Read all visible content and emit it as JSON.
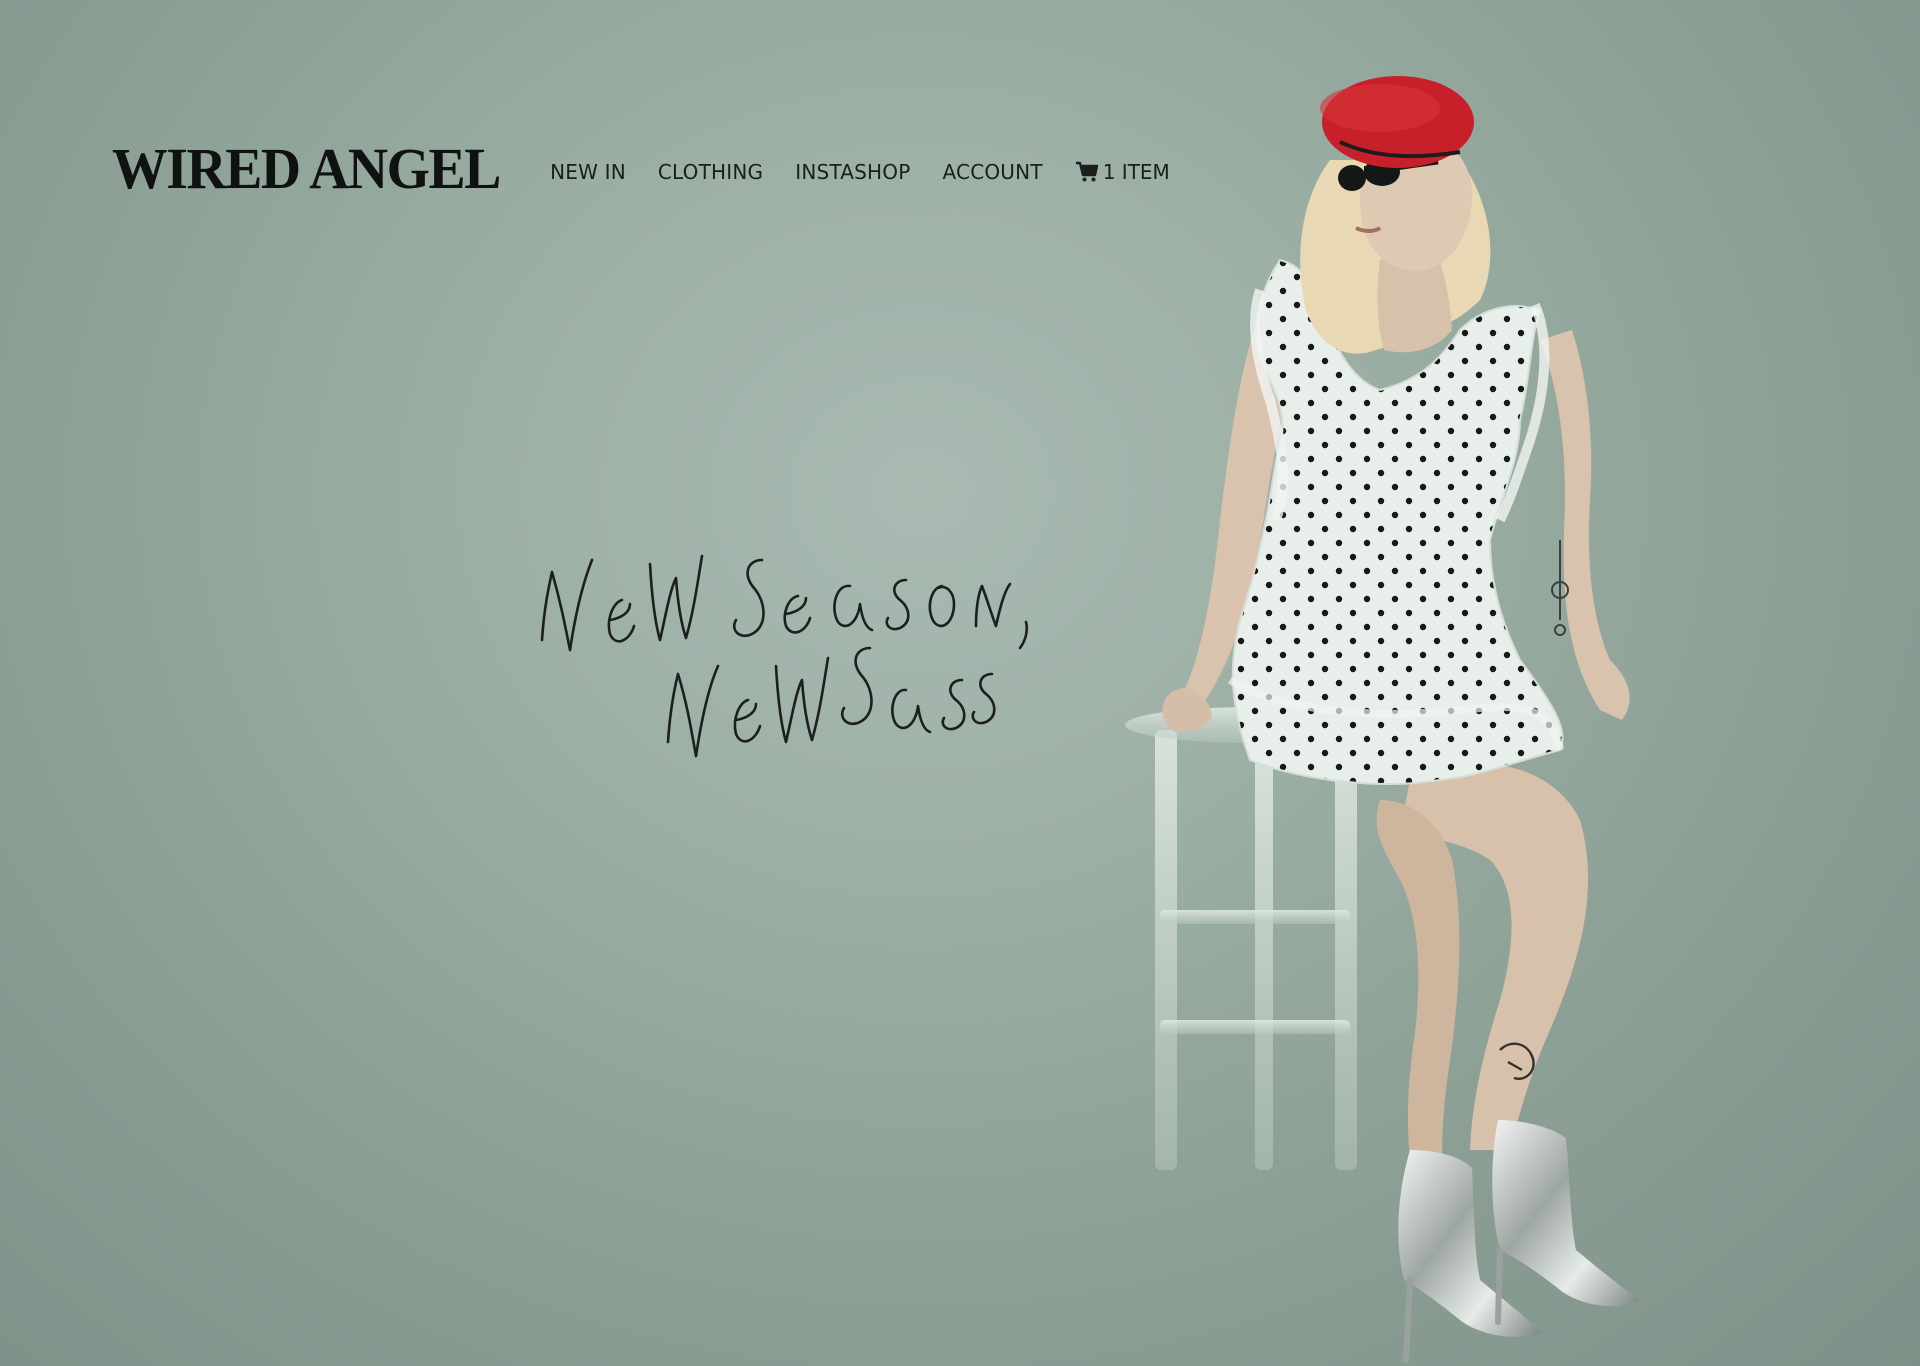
{
  "brand": {
    "logo_text": "WIRED ANGEL"
  },
  "nav": {
    "items": [
      {
        "label": "NEW IN"
      },
      {
        "label": "CLOTHING"
      },
      {
        "label": "INSTASHOP"
      },
      {
        "label": "ACCOUNT"
      }
    ],
    "cart": {
      "icon": "cart-icon",
      "label": "1 ITEM"
    }
  },
  "hero": {
    "tagline": "new season, new sass",
    "image": "model-in-polka-dot-dress"
  },
  "colors": {
    "background": "#9db0a6",
    "text": "#0f1211",
    "beret": "#c8202a"
  }
}
